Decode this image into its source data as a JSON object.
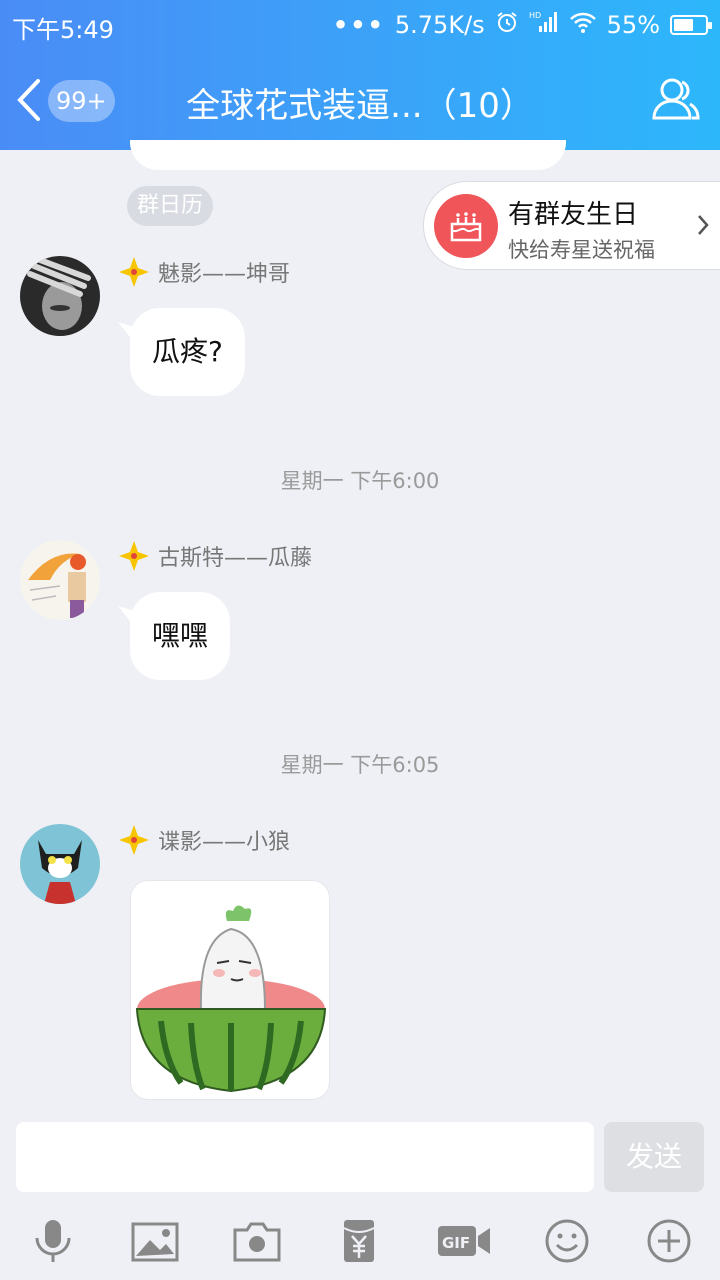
{
  "status_bar": {
    "time": "下午5:49",
    "net_speed": "5.75K/s",
    "network": "HD",
    "battery": "55%"
  },
  "nav": {
    "back_badge": "99+",
    "title": "全球花式装逼...（10）"
  },
  "calendar_pill": "群日历",
  "birthday_banner": {
    "title": "有群友生日",
    "subtitle": "快给寿星送祝福"
  },
  "messages": [
    {
      "sender": "魅影——坤哥",
      "text": "瓜疼?"
    },
    {
      "sender": "古斯特——瓜藤",
      "text": "嘿嘿"
    },
    {
      "sender": "谍影——小狼",
      "sticker": "watermelon-radish-sticker"
    }
  ],
  "timestamps": [
    "星期一 下午6:00",
    "星期一 下午6:05"
  ],
  "composer": {
    "placeholder": "",
    "send_label": "发送"
  },
  "toolbar": [
    "mic-icon",
    "image-icon",
    "camera-icon",
    "red-envelope-icon",
    "gif-icon",
    "emoji-icon",
    "plus-icon"
  ],
  "colors": {
    "header_start": "#4a8cf6",
    "header_end": "#2db7fb",
    "background": "#eef0f5",
    "birthday_icon": "#f0555a"
  }
}
